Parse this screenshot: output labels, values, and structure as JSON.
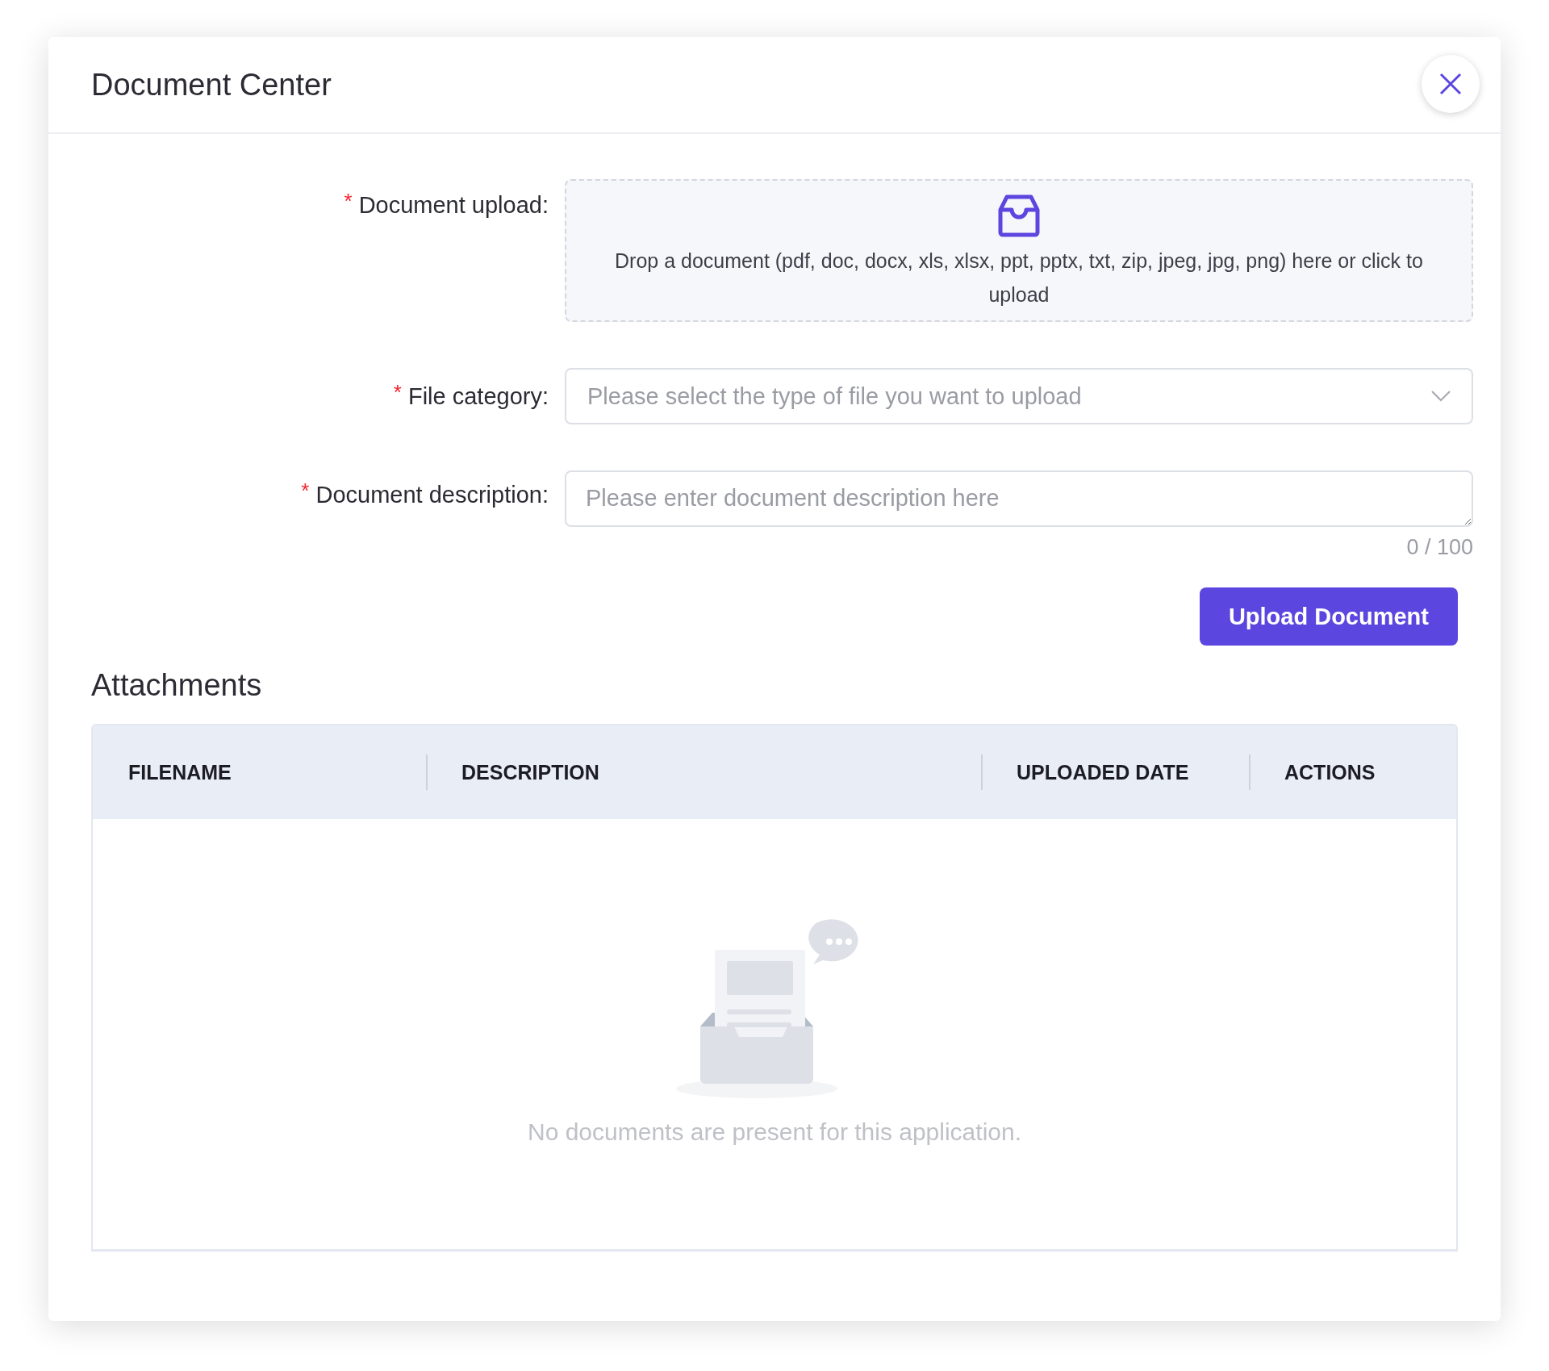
{
  "dialog": {
    "title": "Document Center"
  },
  "form": {
    "fields": [
      {
        "kind": "upload",
        "label": "Document upload:",
        "required": true,
        "required_mark": "*",
        "hint": "Drop a document (pdf, doc, docx, xls, xlsx, ppt, pptx, txt, zip, jpeg, jpg, png) here or click to upload"
      },
      {
        "kind": "select",
        "label": "File category:",
        "required": true,
        "required_mark": "*",
        "placeholder": "Please select the type of file you want to upload"
      },
      {
        "kind": "textarea",
        "label": "Document description:",
        "required": true,
        "required_mark": "*",
        "placeholder": "Please enter document description here",
        "counter": "0 / 100"
      }
    ],
    "submit": "Upload Document"
  },
  "attachments": {
    "title": "Attachments",
    "columns": [
      "FILENAME",
      "DESCRIPTION",
      "UPLOADED DATE",
      "ACTIONS"
    ],
    "empty_message": "No documents are present for this application."
  }
}
